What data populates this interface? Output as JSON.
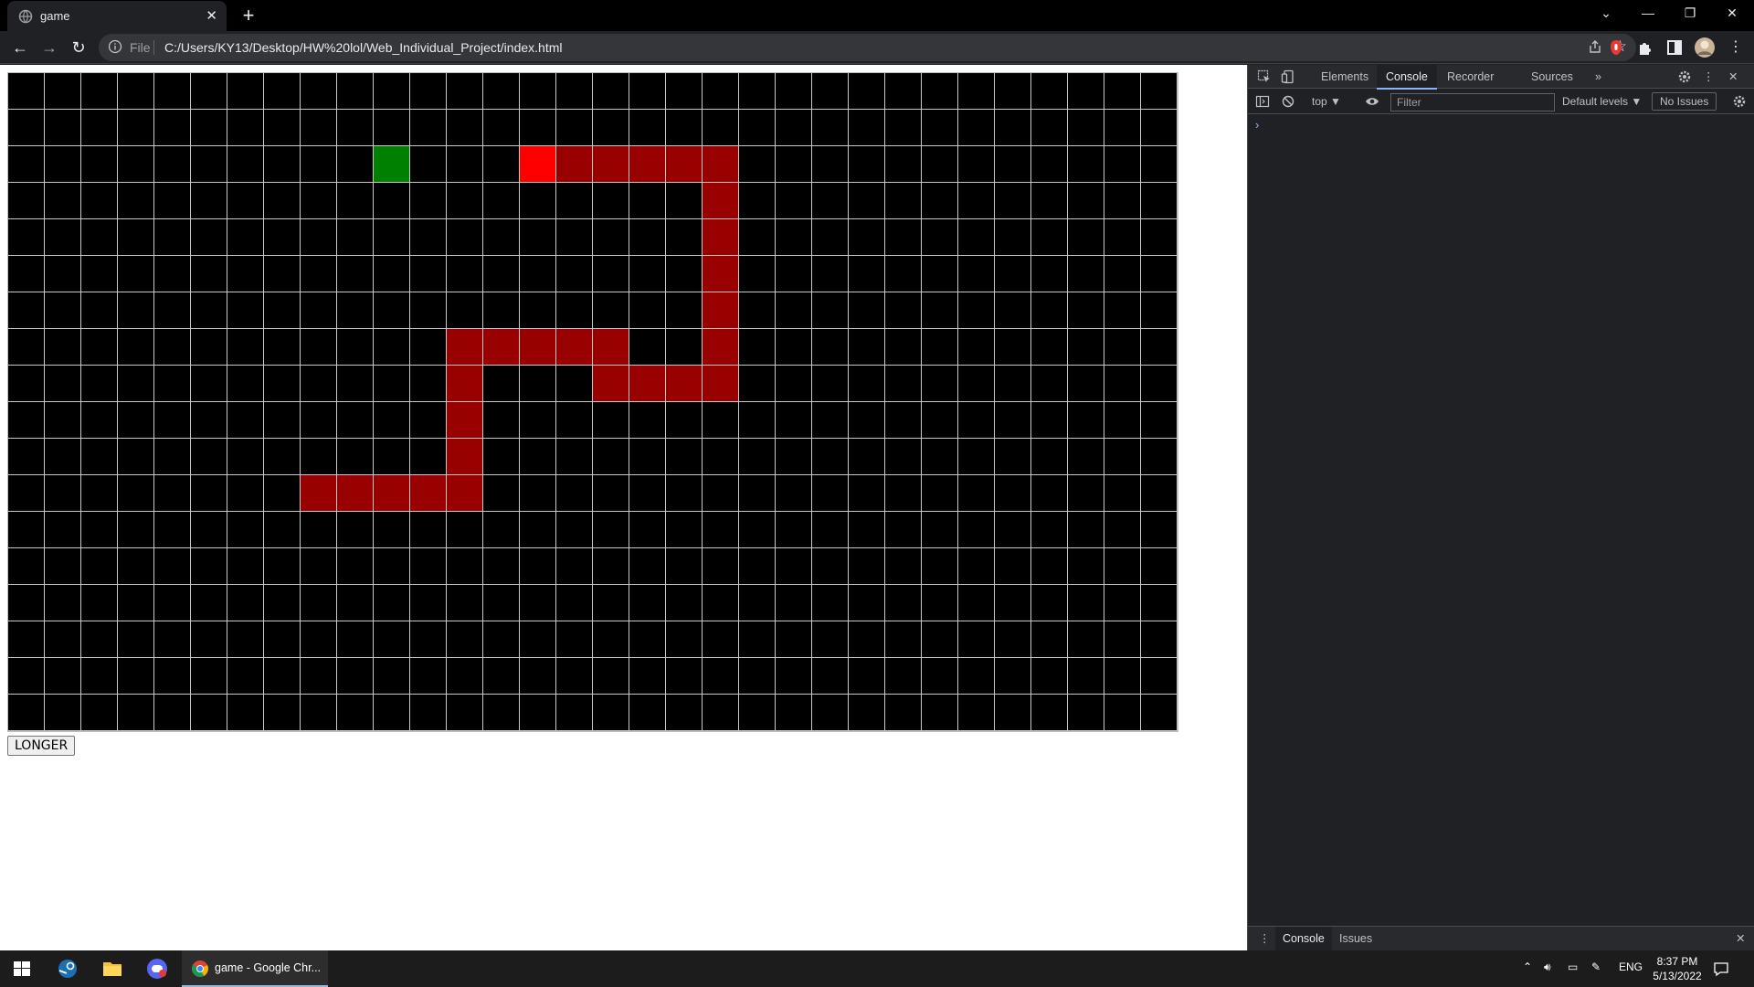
{
  "browser": {
    "tab_title": "game",
    "url_scheme": "File",
    "url": "C:/Users/KY13/Desktop/HW%20lol/Web_Individual_Project/index.html"
  },
  "game": {
    "columns": 32,
    "rows": 18,
    "colors": {
      "background": "#000000",
      "snake_body": "#990000",
      "snake_head": "#ff0000",
      "food": "#008000",
      "grid_line": "#c8c8c8"
    },
    "food": [
      10,
      2
    ],
    "snake_head": [
      14,
      2
    ],
    "snake_body": [
      [
        15,
        2
      ],
      [
        16,
        2
      ],
      [
        17,
        2
      ],
      [
        18,
        2
      ],
      [
        19,
        2
      ],
      [
        19,
        3
      ],
      [
        19,
        4
      ],
      [
        19,
        5
      ],
      [
        19,
        6
      ],
      [
        19,
        7
      ],
      [
        19,
        8
      ],
      [
        18,
        8
      ],
      [
        17,
        8
      ],
      [
        16,
        8
      ],
      [
        16,
        7
      ],
      [
        15,
        7
      ],
      [
        14,
        7
      ],
      [
        13,
        7
      ],
      [
        12,
        7
      ],
      [
        12,
        8
      ],
      [
        12,
        9
      ],
      [
        12,
        10
      ],
      [
        12,
        11
      ],
      [
        11,
        11
      ],
      [
        10,
        11
      ],
      [
        9,
        11
      ],
      [
        8,
        11
      ]
    ],
    "button_label": "LONGER"
  },
  "devtools": {
    "tabs": [
      "Elements",
      "Console",
      "Recorder",
      "Sources"
    ],
    "active_tab": "Console",
    "context": "top ▼",
    "filter_placeholder": "Filter",
    "levels": "Default levels ▼",
    "issues": "No Issues",
    "prompt": "›",
    "drawer_tabs": [
      "Console",
      "Issues"
    ]
  },
  "taskbar": {
    "chrome_label": "game - Google Chr...",
    "lang": "ENG",
    "time": "8:37 PM",
    "date": "5/13/2022"
  }
}
